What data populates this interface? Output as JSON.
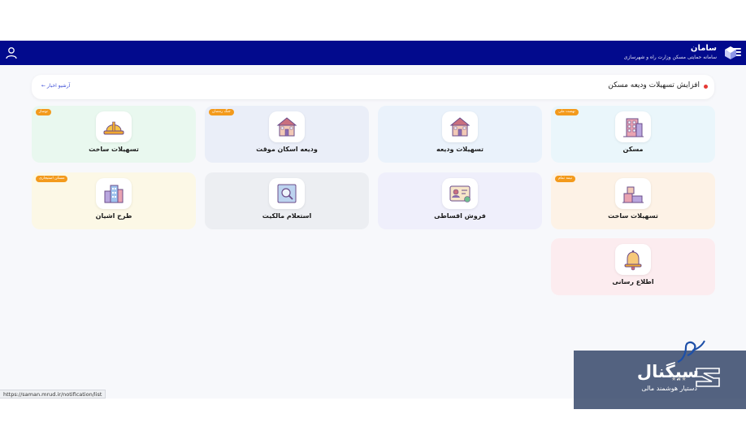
{
  "header": {
    "title": "سامان",
    "subtitle": "سامانه حمایتی مسکن وزارت راه و شهرسازی",
    "bg_color": "#020a8d"
  },
  "news": {
    "headline": "افزایش تسهیلات ودیعه مسکن",
    "archive_label": "آرشیو اخبار ←"
  },
  "cards": [
    {
      "label": "مسکن",
      "badge": "نهضت ملی",
      "icon": "apartment-building-icon",
      "bg": "#eaf6fb"
    },
    {
      "label": "تسهیلات ودیعه",
      "badge": "",
      "icon": "house-icon",
      "bg": "#eaf2fb"
    },
    {
      "label": "ودیعه اسکان موقت",
      "badge": "جنگ رمضان",
      "icon": "house-icon",
      "bg": "#eaeef8"
    },
    {
      "label": "تسهیلات ساخت",
      "badge": "نوساز",
      "icon": "hard-hat-icon",
      "bg": "#e9f8ef"
    },
    {
      "label": "تسهیلات ساخت",
      "badge": "نیمه تمام",
      "icon": "construction-blocks-icon",
      "bg": "#fdf2e6"
    },
    {
      "label": "فروش اقساطی",
      "badge": "",
      "icon": "id-card-icon",
      "bg": "#efeffb"
    },
    {
      "label": "استعلام مالکیت",
      "badge": "",
      "icon": "search-document-icon",
      "bg": "#eceef2"
    },
    {
      "label": "طرح اشیان",
      "badge": "مسکن استیجاری",
      "icon": "city-buildings-icon",
      "bg": "#fcf8e6"
    },
    {
      "label": "اطلاع رسانی",
      "badge": "",
      "icon": "bell-icon",
      "bg": "#fcecef"
    }
  ],
  "status_url": "https://saman.mrud.ir/notification/list",
  "watermark": {
    "title": "سیگنال",
    "subtitle": "دستیار هوشمند مالی"
  }
}
